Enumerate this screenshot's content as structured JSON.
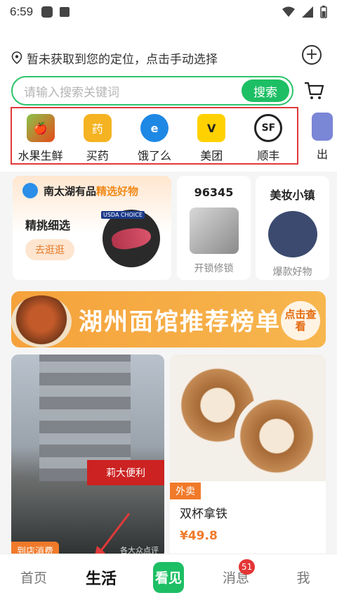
{
  "status_bar": {
    "time": "6:59"
  },
  "location": {
    "text": "暂未获取到您的定位，点击手动选择"
  },
  "search": {
    "placeholder": "请输入搜索关键词",
    "button": "搜索"
  },
  "quick_categories": [
    {
      "label": "水果生鲜",
      "icon": "fruit-icon",
      "color": "#6aa83a"
    },
    {
      "label": "买药",
      "icon": "medicine-icon",
      "color": "#f5a623"
    },
    {
      "label": "饿了么",
      "icon": "eleme-icon",
      "color": "#1e88e5"
    },
    {
      "label": "美团",
      "icon": "meituan-icon",
      "color": "#ffd100"
    },
    {
      "label": "顺丰",
      "icon": "sf-icon",
      "color": "#222222"
    }
  ],
  "quick_categories_extra": {
    "label": "出"
  },
  "promo": {
    "brand": "南太湖有品",
    "accent": "精选好物",
    "subtitle": "精挑细选",
    "button": "去逛逛",
    "usda": "USDA CHOICE"
  },
  "mini_cards": [
    {
      "title": "96345",
      "label": "开锁修锁"
    },
    {
      "title": "美妆小镇",
      "label": "爆款好物"
    }
  ],
  "banner": {
    "title": "湖州面馆推荐榜单",
    "cta": "点击查看"
  },
  "feed": {
    "shop": {
      "sign": "莉大便利",
      "badge": "到店消费",
      "caption": "各大众点评"
    },
    "coffee": {
      "tag": "外卖",
      "name": "双杯拿铁",
      "price": "¥49.8"
    }
  },
  "tabbar": {
    "home": "首页",
    "life": "生活",
    "center": "看见",
    "messages": "消息",
    "messages_badge": "51",
    "me": "我"
  },
  "colors": {
    "brand_green": "#1dbf64",
    "highlight_red": "#e03a3a",
    "accent_orange": "#f07a2a"
  }
}
